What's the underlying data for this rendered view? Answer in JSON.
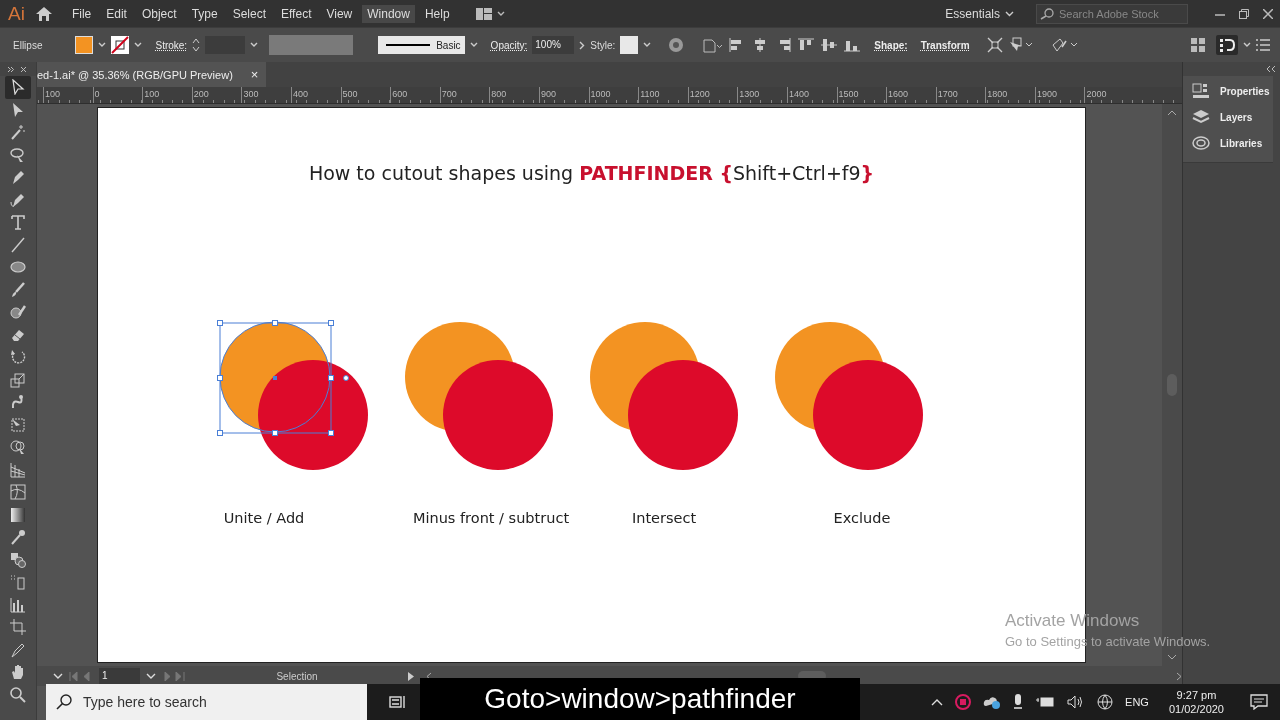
{
  "app": {
    "logo": "Ai"
  },
  "menu": [
    {
      "label": "File",
      "hovered": false
    },
    {
      "label": "Edit",
      "hovered": false
    },
    {
      "label": "Object",
      "hovered": false
    },
    {
      "label": "Type",
      "hovered": false
    },
    {
      "label": "Select",
      "hovered": false
    },
    {
      "label": "Effect",
      "hovered": false
    },
    {
      "label": "View",
      "hovered": false
    },
    {
      "label": "Window",
      "hovered": true
    },
    {
      "label": "Help",
      "hovered": false
    }
  ],
  "workspace": {
    "label": "Essentials"
  },
  "stock_search": {
    "placeholder": "Search Adobe Stock"
  },
  "control_bar": {
    "object_type": "Ellipse",
    "stroke_label": "Stroke:",
    "brush": "Basic",
    "opacity_label": "Opacity:",
    "opacity": "100%",
    "style_label": "Style:",
    "shape_label": "Shape:",
    "transform_label": "Transform"
  },
  "document_tab": {
    "title": "ed-1.ai* @ 35.36% (RGB/GPU Preview)",
    "close": "×"
  },
  "ruler": [
    "100",
    "0",
    "100",
    "200",
    "300",
    "400",
    "500",
    "600",
    "700",
    "800",
    "900",
    "1000",
    "1100",
    "1200",
    "1300",
    "1400",
    "1500",
    "1600",
    "1700",
    "1800",
    "1900",
    "2000"
  ],
  "tools": [
    {
      "kind": "selection",
      "selected": true
    },
    {
      "kind": "direct",
      "selected": false
    },
    {
      "kind": "wand",
      "selected": false
    },
    {
      "kind": "lasso",
      "selected": false
    },
    {
      "kind": "pen",
      "selected": false
    },
    {
      "kind": "curvature",
      "selected": false
    },
    {
      "kind": "type",
      "selected": false
    },
    {
      "kind": "line",
      "selected": false
    },
    {
      "kind": "ellipse",
      "selected": false
    },
    {
      "kind": "brush",
      "selected": false
    },
    {
      "kind": "blob",
      "selected": false
    },
    {
      "kind": "eraser",
      "selected": false
    },
    {
      "kind": "rotate",
      "selected": false
    },
    {
      "kind": "scale",
      "selected": false
    },
    {
      "kind": "warp",
      "selected": false
    },
    {
      "kind": "transform",
      "selected": false
    },
    {
      "kind": "builder",
      "selected": false
    },
    {
      "kind": "perspective",
      "selected": false
    },
    {
      "kind": "mesh",
      "selected": false
    },
    {
      "kind": "gradient",
      "selected": false
    },
    {
      "kind": "eyedropper",
      "selected": false
    },
    {
      "kind": "blend",
      "selected": false
    },
    {
      "kind": "sprayer",
      "selected": false
    },
    {
      "kind": "graph",
      "selected": false
    },
    {
      "kind": "artboard",
      "selected": false
    },
    {
      "kind": "slice",
      "selected": false
    },
    {
      "kind": "hand",
      "selected": false
    },
    {
      "kind": "zoom",
      "selected": false
    }
  ],
  "artboard": {
    "heading": "How to cutout shapes using **PATHFINDER {**Shift+Ctrl+f9**}**",
    "examples": [
      {
        "label": "Unite / Add",
        "selected": true
      },
      {
        "label": "Minus front / subtruct",
        "selected": false
      },
      {
        "label": "Intersect",
        "selected": false
      },
      {
        "label": "Exclude",
        "selected": false
      }
    ]
  },
  "panels": [
    {
      "kind": "properties",
      "label": "Properties"
    },
    {
      "kind": "layers",
      "label": "Layers"
    },
    {
      "kind": "libraries",
      "label": "Libraries"
    }
  ],
  "status_bar": {
    "page": "1",
    "tool": "Selection"
  },
  "activation_notice": {
    "title": "Activate Windows",
    "text": "Go to Settings to activate Windows."
  },
  "taskbar": {
    "search_placeholder": "Type here to search",
    "language": "ENG",
    "time": "9:27 pm",
    "date": "01/02/2020"
  },
  "caption": "Goto>window>pathfinder"
}
